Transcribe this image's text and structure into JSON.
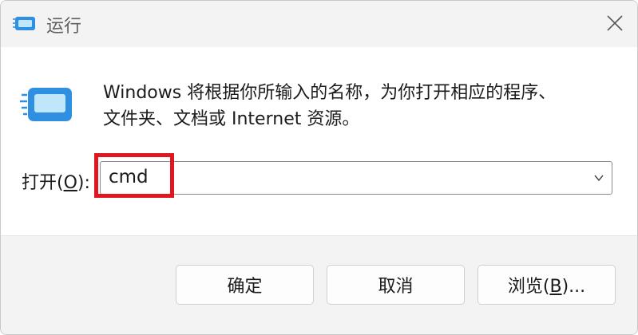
{
  "window": {
    "title": "运行"
  },
  "description": {
    "line1": "Windows 将根据你所输入的名称，为你打开相应的程序、",
    "line2": "文件夹、文档或 Internet 资源。"
  },
  "open_field": {
    "label_prefix": "打开(",
    "label_accel": "O",
    "label_suffix": "):",
    "value": "cmd"
  },
  "buttons": {
    "ok": "确定",
    "cancel": "取消",
    "browse_prefix": "浏览(",
    "browse_accel": "B",
    "browse_suffix": ")..."
  },
  "colors": {
    "highlight": "#e0171f",
    "icon_blue": "#2f8fe0",
    "icon_light": "#bfe6fb"
  },
  "icons": {
    "title": "run-app-icon",
    "main": "run-app-icon",
    "close": "close-icon",
    "dropdown": "chevron-down-icon"
  }
}
